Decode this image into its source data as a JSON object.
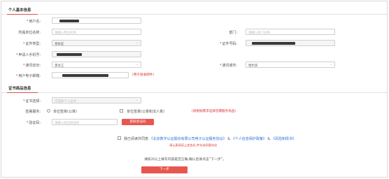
{
  "personal": {
    "title": "个人基本信息",
    "name_label": "用户名:",
    "org_label": "所属单位名称:",
    "org_placeholder": "请输入单位名称",
    "dept_label": "部门:",
    "dept_placeholder": "请输入部门名称",
    "cert_type_label": "证件类型:",
    "cert_type_value": "身份证",
    "cert_no_label": "证件号码:",
    "phone_label": "申请人手机号:",
    "province_label": "通讯省份:",
    "province_value": "黑龙江",
    "city_label": "通讯城市:",
    "city_value": "哈尔滨",
    "email_label": "用户电子邮箱:",
    "email_hint": "(用于接收邮件)"
  },
  "cert": {
    "title": "证书商品信息",
    "choice_label": "证书选择:",
    "choice_placeholder": "可选择个人证书",
    "service_label": "签署服务:",
    "option_unit": "单位签章(公章)",
    "option_legal": "单位签章(公章和法人章)",
    "service_hint": "(请根据需求选择签署服务商品)",
    "code_label": "验证码:",
    "code_placeholder": "请输入短信验证码",
    "code_button": "获取验证码"
  },
  "agreement": {
    "prefix": "我已阅读并同意",
    "link1": "《北京数字认证股份有限公司电子认证服务协议》",
    "sep": "&",
    "link2": "《个人信息保护政策》",
    "link3": "《风险知情书》",
    "warning": "请认真阅读上述协议,并勾选同意协议",
    "confirm": "请核对以上填写内容是否正确,确认后请点击“下一步”。",
    "next_button": "下一步"
  }
}
